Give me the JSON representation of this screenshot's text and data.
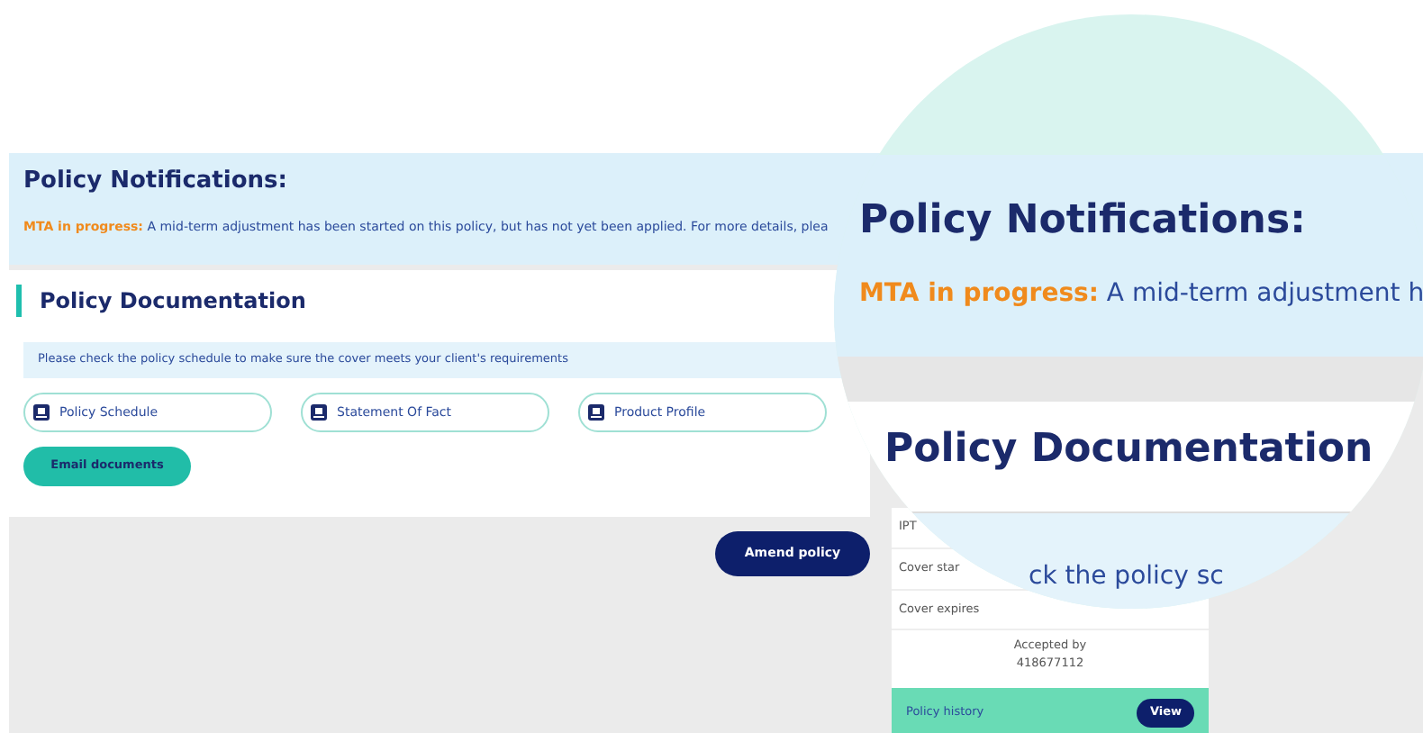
{
  "notifications": {
    "title": "Policy Notifications:",
    "message_label": "MTA in progress:",
    "message": "A mid-term adjustment has been started on this policy, but has not yet been applied. For more details, plea"
  },
  "documentation": {
    "title": "Policy Documentation",
    "hint": "Please check the policy schedule to make sure the cover meets your client's requirements",
    "documents": [
      {
        "label": "Policy Schedule"
      },
      {
        "label": "Statement Of Fact"
      },
      {
        "label": "Product Profile"
      }
    ],
    "email_button": "Email documents"
  },
  "amend_button": "Amend policy",
  "side_panel": {
    "rows": [
      "IPT",
      "Cover star",
      "Cover expires"
    ],
    "accepted_label": "Accepted by",
    "accepted_value": "418677112",
    "history_label": "Policy history",
    "history_button": "View"
  },
  "magnifier": {
    "title": "Policy Notifications:",
    "message_label": "MTA in progress:",
    "message": "A mid-term adjustment h",
    "doc_title": "Policy Documentation",
    "hint_fragment": "ck the policy sc"
  }
}
